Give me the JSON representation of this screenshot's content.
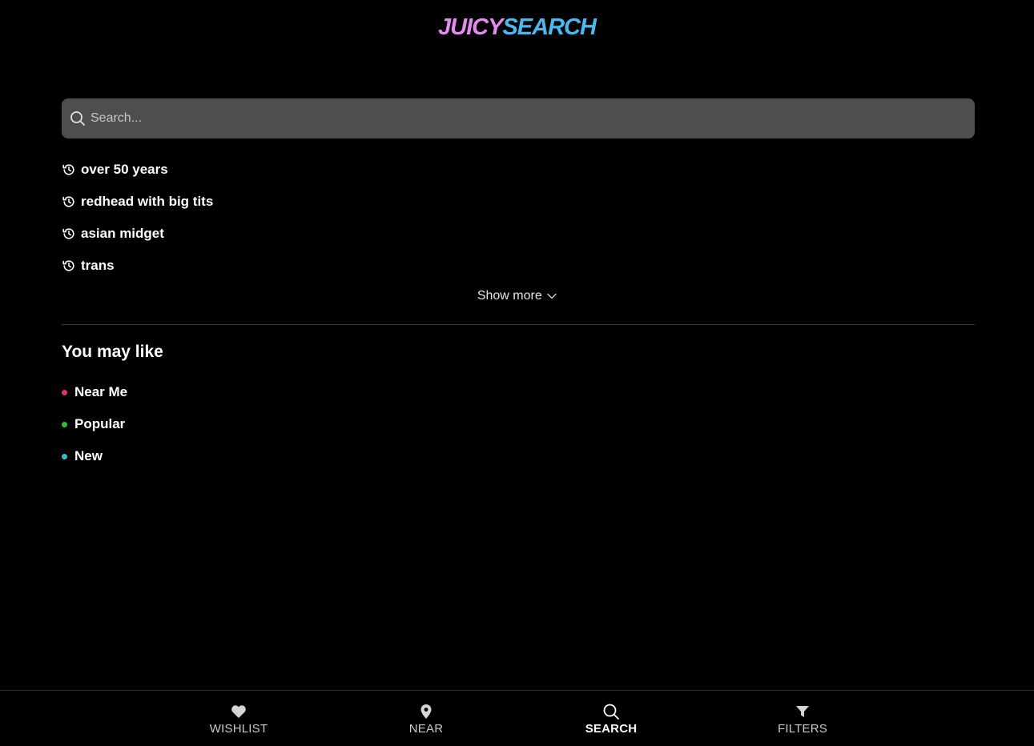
{
  "logo": {
    "part1": "JUICY",
    "part2": "SEARCH"
  },
  "search": {
    "placeholder": "Search..."
  },
  "history": [
    {
      "label": "over 50 years"
    },
    {
      "label": "redhead with big tits"
    },
    {
      "label": "asian midget"
    },
    {
      "label": "trans"
    }
  ],
  "show_more": "Show more",
  "suggestions_title": "You may like",
  "suggestions": [
    {
      "label": "Near Me",
      "color": "#e8335f"
    },
    {
      "label": "Popular",
      "color": "#22c43a"
    },
    {
      "label": "New",
      "color": "#2fc1c9"
    }
  ],
  "nav": {
    "wishlist": "WISHLIST",
    "near": "NEAR",
    "search": "SEARCH",
    "filters": "FILTERS"
  },
  "colors": {
    "background": "#000000",
    "search_bg": "#4d4f4d",
    "logo_pink": "#e48bf2",
    "logo_blue": "#49b9f2"
  }
}
